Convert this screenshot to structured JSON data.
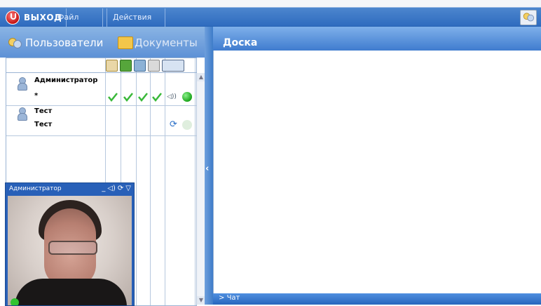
{
  "menu": {
    "logout": "ВЫХОД",
    "file": "Файл",
    "actions": "Действия"
  },
  "left_panel": {
    "tab_users": "Пользователи",
    "tab_documents": "Документы"
  },
  "users": [
    {
      "name": "Администратор",
      "sub": "*",
      "audio_label": "◁))"
    },
    {
      "name": "Тест",
      "sub": "Тест"
    }
  ],
  "board": {
    "title": "Доска"
  },
  "chat": {
    "label": "Чат"
  },
  "video": {
    "title": "Администратор"
  },
  "colors": {
    "topbar": "#2f6cbf",
    "panel_header": "#5d91d6",
    "check": "#39b839",
    "online": "#1aa51a"
  }
}
